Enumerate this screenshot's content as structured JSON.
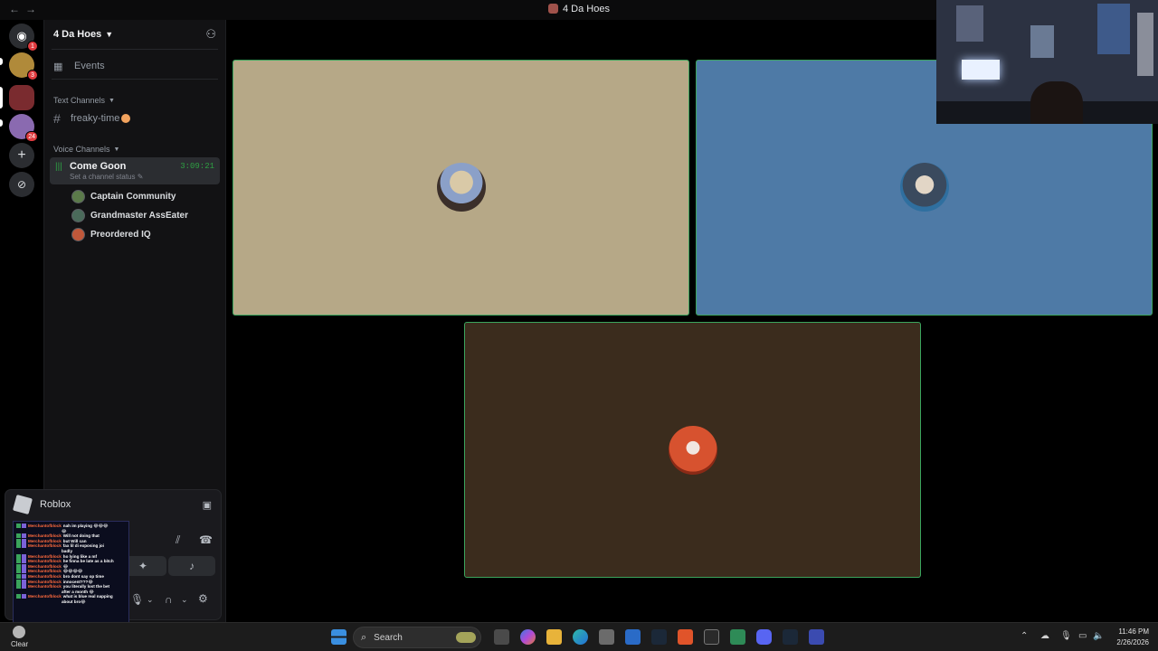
{
  "window": {
    "title": "4 Da Hoes",
    "nav_back": "←",
    "nav_forward": "→"
  },
  "guilds": [
    {
      "name": "discord-home",
      "glyph": "◉",
      "badge": "1",
      "color": "#2b2d31"
    },
    {
      "name": "guild-1",
      "glyph": "",
      "badge": "3",
      "color": "#b08a3a"
    },
    {
      "name": "guild-2",
      "glyph": "",
      "badge": "",
      "color": "#7a2b2f"
    },
    {
      "name": "guild-3",
      "glyph": "",
      "badge": "24",
      "color": "#8a6ab0"
    },
    {
      "name": "add-server",
      "glyph": "+",
      "badge": "",
      "color": "#2b2d31"
    },
    {
      "name": "discover",
      "glyph": "⊘",
      "badge": "",
      "color": "#2b2d31"
    }
  ],
  "server": {
    "name": "4 Da Hoes",
    "events_label": "Events",
    "text_category": "Text Channels",
    "text_channels": [
      {
        "name": "freaky-time"
      }
    ],
    "voice_category": "Voice Channels",
    "voice_channel": {
      "name": "Come Goon",
      "timer": "3:09:21",
      "status_placeholder": "Set a channel status"
    },
    "members": [
      {
        "name": "Captain Community",
        "avatar_color": "#5b7a4a"
      },
      {
        "name": "Grandmaster AssEater",
        "avatar_color": "#4a6a5a"
      },
      {
        "name": "Preordered IQ",
        "avatar_color": "#c0583a"
      }
    ]
  },
  "activity": {
    "title": "Roblox"
  },
  "chat_overlay": {
    "lines": [
      {
        "user": "Merchantofblock",
        "text": "nah im playing 😂😂😂"
      },
      {
        "user": "",
        "text": "😂"
      },
      {
        "user": "Merchantofblock",
        "text": "Will not doing that"
      },
      {
        "user": "Merchantofblock",
        "text": "but Will can"
      },
      {
        "user": "Merchantofblock",
        "text": "fax lil di exposing joi"
      },
      {
        "user": "",
        "text": "badly"
      },
      {
        "user": "Merchantofblock",
        "text": "ho lying like a mf"
      },
      {
        "user": "Merchantofblock",
        "text": "he finna be late as a bitch"
      },
      {
        "user": "Merchantofblock",
        "text": "😂"
      },
      {
        "user": "Merchantofblock",
        "text": "😂😂😂😂"
      },
      {
        "user": "Merchantofblock",
        "text": "bro dont say op time"
      },
      {
        "user": "Merchantofblock",
        "text": "innocent???😂"
      },
      {
        "user": "Merchantofblock",
        "text": "you literally lost the bet"
      },
      {
        "user": "",
        "text": "after a month 😂"
      },
      {
        "user": "Merchantofblock",
        "text": "what is blue real napping"
      },
      {
        "user": "",
        "text": "about bro😂"
      }
    ]
  },
  "tiles": [
    {
      "name": "video-tile-1",
      "bg": "#b6a887",
      "avatar": "#8ba0c8"
    },
    {
      "name": "video-tile-2",
      "bg": "#4e7aa6",
      "avatar": "#3a4a5e"
    },
    {
      "name": "video-tile-3",
      "bg": "#3b2c1d",
      "avatar": "#d7522f"
    }
  ],
  "taskbar": {
    "weather": "Clear",
    "search_placeholder": "Search",
    "time": "11:46 PM",
    "date": "2/26/2026"
  }
}
